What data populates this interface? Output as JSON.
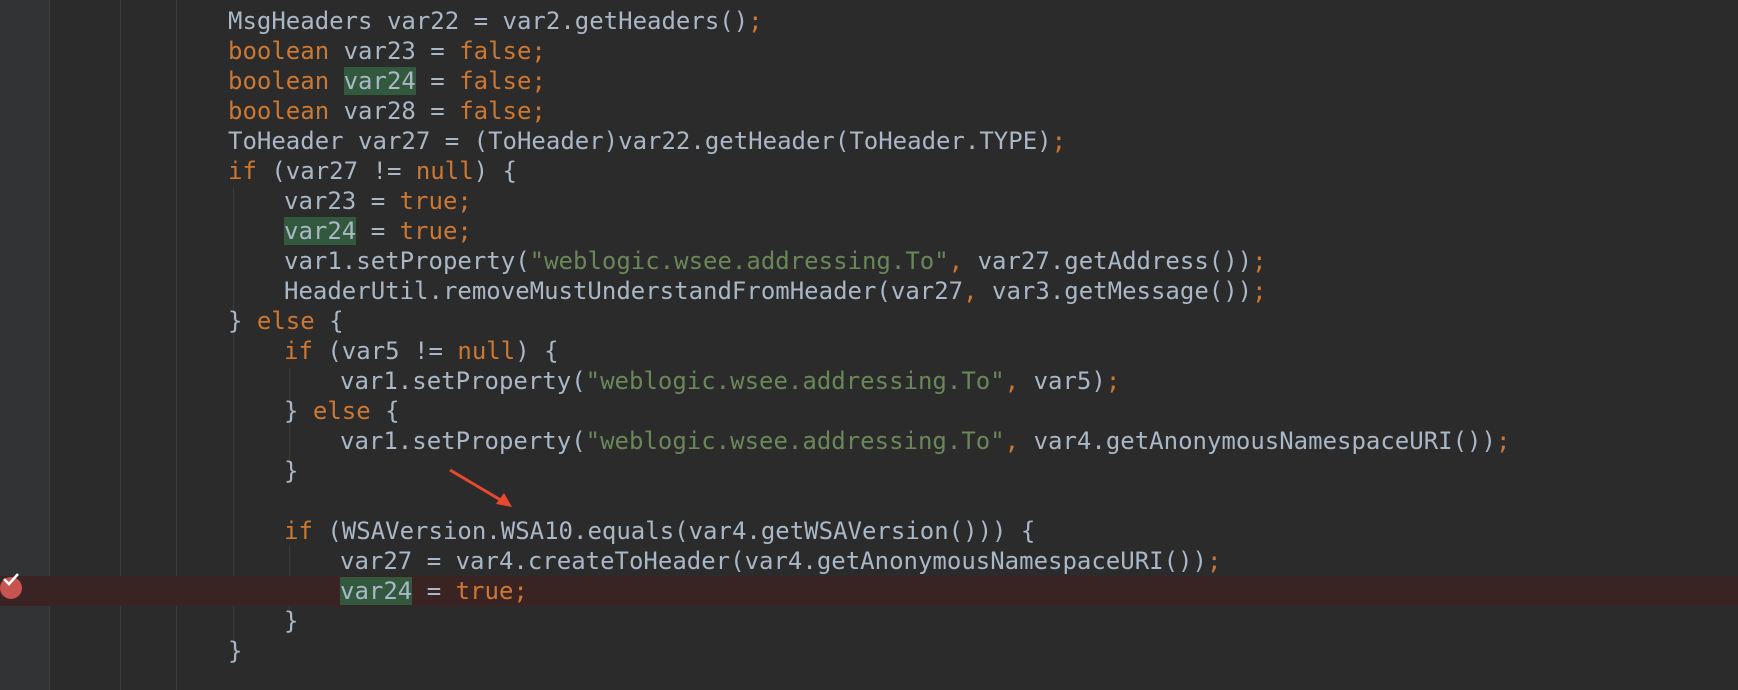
{
  "editor": {
    "colors": {
      "background": "#2b2b2b",
      "keyword": "#cc7832",
      "string": "#6a8759",
      "plain": "#a9b7c6",
      "highlight": "#32593d",
      "breakpoint_line": "#3a2323",
      "breakpoint": "#c75450",
      "annotation_arrow": "#e8482f"
    },
    "gutter": {
      "breakpoint_icon": "breakpoint-verified-icon"
    },
    "lines": [
      {
        "tokens": [
          {
            "t": "pl",
            "v": "MsgHeaders var22 = var2.getHeaders()"
          },
          {
            "t": "kw",
            "v": ";"
          }
        ]
      },
      {
        "tokens": [
          {
            "t": "kw",
            "v": "boolean "
          },
          {
            "t": "pl",
            "v": "var23 = "
          },
          {
            "t": "kw",
            "v": "false;"
          }
        ]
      },
      {
        "tokens": [
          {
            "t": "kw",
            "v": "boolean "
          },
          {
            "t": "hl",
            "v": "var24"
          },
          {
            "t": "pl",
            "v": " = "
          },
          {
            "t": "kw",
            "v": "false;"
          }
        ]
      },
      {
        "tokens": [
          {
            "t": "kw",
            "v": "boolean "
          },
          {
            "t": "pl",
            "v": "var28 = "
          },
          {
            "t": "kw",
            "v": "false;"
          }
        ]
      },
      {
        "tokens": [
          {
            "t": "pl",
            "v": "ToHeader var27 = (ToHeader)var22.getHeader(ToHeader.TYPE)"
          },
          {
            "t": "kw",
            "v": ";"
          }
        ]
      },
      {
        "tokens": [
          {
            "t": "kw",
            "v": "if "
          },
          {
            "t": "pl",
            "v": "(var27 != "
          },
          {
            "t": "kw",
            "v": "null"
          },
          {
            "t": "pl",
            "v": ") {"
          }
        ]
      },
      {
        "tokens": [
          {
            "t": "pl",
            "v": "var23 = "
          },
          {
            "t": "kw",
            "v": "true;"
          }
        ]
      },
      {
        "tokens": [
          {
            "t": "hl",
            "v": "var24"
          },
          {
            "t": "pl",
            "v": " = "
          },
          {
            "t": "kw",
            "v": "true;"
          }
        ]
      },
      {
        "tokens": [
          {
            "t": "pl",
            "v": "var1.setProperty("
          },
          {
            "t": "str",
            "v": "\"weblogic.wsee.addressing.To\""
          },
          {
            "t": "kw",
            "v": ", "
          },
          {
            "t": "pl",
            "v": "var27.getAddress())"
          },
          {
            "t": "kw",
            "v": ";"
          }
        ]
      },
      {
        "tokens": [
          {
            "t": "pl",
            "v": "HeaderUtil.removeMustUnderstandFromHeader(var27"
          },
          {
            "t": "kw",
            "v": ", "
          },
          {
            "t": "pl",
            "v": "var3.getMessage())"
          },
          {
            "t": "kw",
            "v": ";"
          }
        ]
      },
      {
        "tokens": [
          {
            "t": "pl",
            "v": "} "
          },
          {
            "t": "kw",
            "v": "else "
          },
          {
            "t": "pl",
            "v": "{"
          }
        ]
      },
      {
        "tokens": [
          {
            "t": "kw",
            "v": "if "
          },
          {
            "t": "pl",
            "v": "(var5 != "
          },
          {
            "t": "kw",
            "v": "null"
          },
          {
            "t": "pl",
            "v": ") {"
          }
        ]
      },
      {
        "tokens": [
          {
            "t": "pl",
            "v": "var1.setProperty("
          },
          {
            "t": "str",
            "v": "\"weblogic.wsee.addressing.To\""
          },
          {
            "t": "kw",
            "v": ", "
          },
          {
            "t": "pl",
            "v": "var5)"
          },
          {
            "t": "kw",
            "v": ";"
          }
        ]
      },
      {
        "tokens": [
          {
            "t": "pl",
            "v": "} "
          },
          {
            "t": "kw",
            "v": "else "
          },
          {
            "t": "pl",
            "v": "{"
          }
        ]
      },
      {
        "tokens": [
          {
            "t": "pl",
            "v": "var1.setProperty("
          },
          {
            "t": "str",
            "v": "\"weblogic.wsee.addressing.To\""
          },
          {
            "t": "kw",
            "v": ", "
          },
          {
            "t": "pl",
            "v": "var4.getAnonymousNamespaceURI())"
          },
          {
            "t": "kw",
            "v": ";"
          }
        ]
      },
      {
        "tokens": [
          {
            "t": "pl",
            "v": "}"
          }
        ]
      },
      {
        "tokens": []
      },
      {
        "tokens": [
          {
            "t": "kw",
            "v": "if "
          },
          {
            "t": "pl",
            "v": "(WSAVersion.WSA10.equals(var4.getWSAVersion())) {"
          }
        ]
      },
      {
        "tokens": [
          {
            "t": "pl",
            "v": "var27 = var4.createToHeader(var4.getAnonymousNamespaceURI())"
          },
          {
            "t": "kw",
            "v": ";"
          }
        ]
      },
      {
        "tokens": [
          {
            "t": "hl",
            "v": "var24"
          },
          {
            "t": "pl",
            "v": " = "
          },
          {
            "t": "kw",
            "v": "true;"
          }
        ],
        "breakpoint": true
      },
      {
        "tokens": [
          {
            "t": "pl",
            "v": "}"
          }
        ]
      },
      {
        "tokens": [
          {
            "t": "pl",
            "v": "}"
          }
        ]
      }
    ]
  }
}
